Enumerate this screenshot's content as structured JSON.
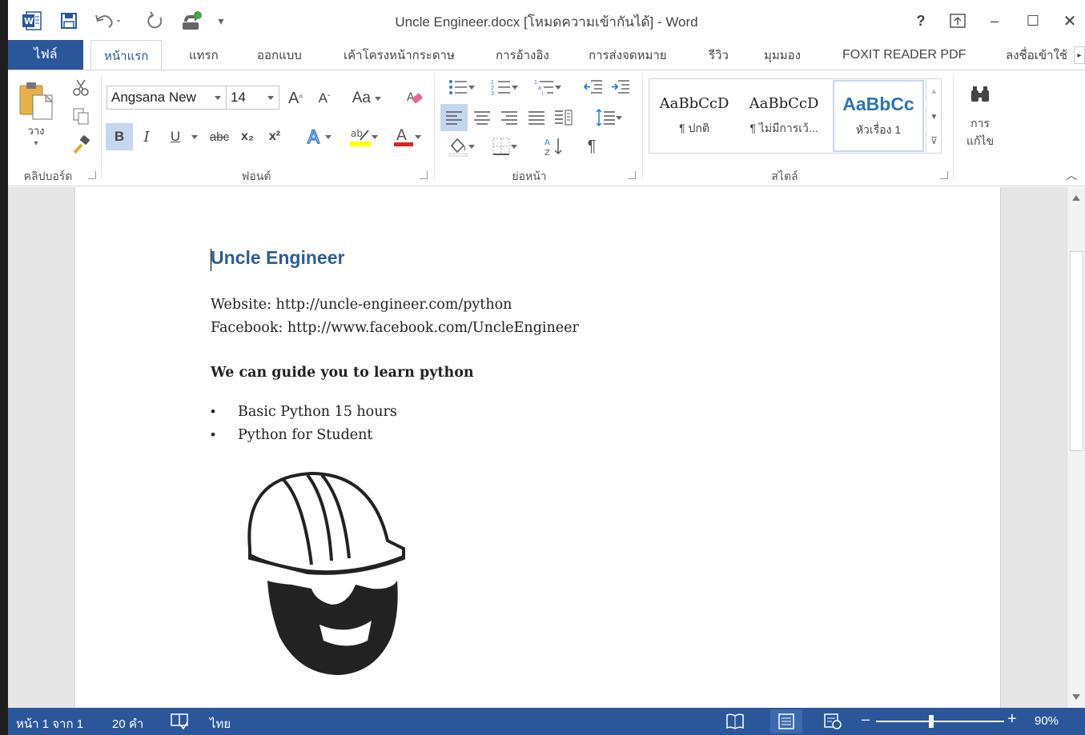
{
  "window": {
    "title": "Uncle Engineer.docx [โหมดความเข้ากันได้] - Word",
    "help": "?",
    "minimize": "–",
    "maximize": "☐",
    "close": "✕"
  },
  "tabs": {
    "file": "ไฟล์",
    "items": [
      {
        "label": "หน้าแรก",
        "active": true
      },
      {
        "label": "แทรก"
      },
      {
        "label": "ออกแบบ"
      },
      {
        "label": "เค้าโครงหน้ากระดาษ"
      },
      {
        "label": "การอ้างอิง"
      },
      {
        "label": "การส่งจดหมาย"
      },
      {
        "label": "รีวิว"
      },
      {
        "label": "มุมมอง"
      },
      {
        "label": "FOXIT READER PDF"
      },
      {
        "label": "ลงชื่อเข้าใช้"
      }
    ]
  },
  "ribbon": {
    "clipboard": {
      "label": "คลิปบอร์ด",
      "paste": "วาง"
    },
    "font": {
      "label": "ฟอนต์",
      "name": "Angsana New",
      "size": "14",
      "case": "Aa",
      "bold": "B",
      "italic": "I",
      "underline": "U",
      "strike": "abc",
      "sub": "x₂",
      "sup": "x²"
    },
    "paragraph": {
      "label": "ย่อหน้า"
    },
    "styles": {
      "label": "สไตล์",
      "items": [
        {
          "preview": "AaBbCcD",
          "name": "¶ ปกติ"
        },
        {
          "preview": "AaBbCcD",
          "name": "¶ ไม่มีการเว้..."
        },
        {
          "preview": "AaBbCc",
          "name": "หัวเรื่อง 1",
          "selected": true
        }
      ]
    },
    "editing": {
      "label1": "การ",
      "label2": "แก้ไข"
    }
  },
  "document": {
    "heading": "Uncle Engineer",
    "website": "Website: http://uncle-engineer.com/python",
    "facebook": "Facebook: http://www.facebook.com/UncleEngineer",
    "guide": "We can guide you to learn python",
    "bullets": [
      "Basic Python 15 hours",
      "Python for Student"
    ]
  },
  "status": {
    "page": "หน้า 1 จาก 1",
    "words": "20 คำ",
    "language": "ไทย",
    "zoom": "90%",
    "zoom_minus": "–",
    "zoom_plus": "+"
  }
}
